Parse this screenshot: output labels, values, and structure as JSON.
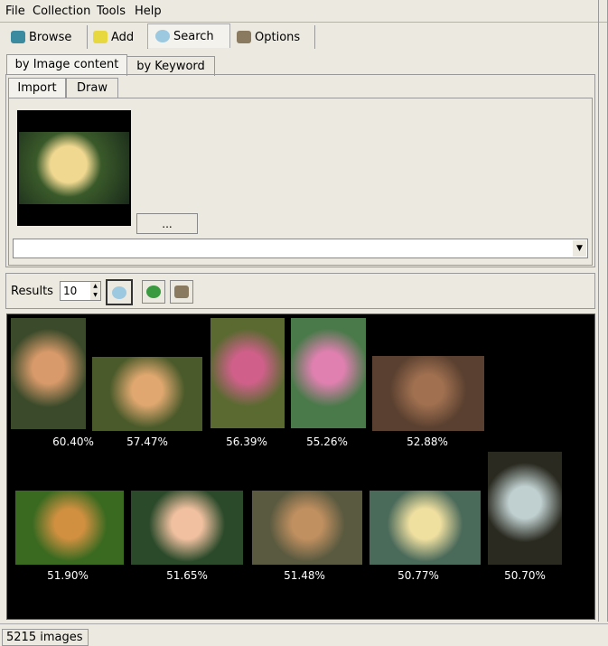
{
  "menu": [
    "File",
    "Collection",
    "Tools",
    "Help"
  ],
  "toolbar": [
    {
      "label": "Browse",
      "icon": "book-icon"
    },
    {
      "label": "Add",
      "icon": "add-image-icon"
    },
    {
      "label": "Search",
      "icon": "magnifier-icon"
    },
    {
      "label": "Options",
      "icon": "tools-icon"
    }
  ],
  "search_tabs": [
    "by Image content",
    "by Keyword"
  ],
  "source_tabs": [
    "Import",
    "Draw"
  ],
  "browse_button": "...",
  "path_combo": "",
  "results": {
    "label": "Results",
    "count": "10"
  },
  "thumbnails": [
    {
      "score": "60.40%",
      "colors": [
        "#d89a6a",
        "#3a4a2a"
      ]
    },
    {
      "score": "57.47%",
      "colors": [
        "#e0a870",
        "#4a5a2a"
      ]
    },
    {
      "score": "56.39%",
      "colors": [
        "#d0608a",
        "#5a6a30"
      ]
    },
    {
      "score": "55.26%",
      "colors": [
        "#e080b0",
        "#4a7a4a"
      ]
    },
    {
      "score": "52.88%",
      "colors": [
        "#a07050",
        "#5a4030"
      ]
    },
    {
      "score": "51.90%",
      "colors": [
        "#d09040",
        "#3a6a20"
      ]
    },
    {
      "score": "51.65%",
      "colors": [
        "#f0c0a0",
        "#2a4a2a"
      ]
    },
    {
      "score": "51.48%",
      "colors": [
        "#c09060",
        "#5a5a40"
      ]
    },
    {
      "score": "50.77%",
      "colors": [
        "#f0e0a0",
        "#4a6a5a"
      ]
    },
    {
      "score": "50.70%",
      "colors": [
        "#c0d0d0",
        "#2a2a20"
      ]
    }
  ],
  "status": "5215 images"
}
